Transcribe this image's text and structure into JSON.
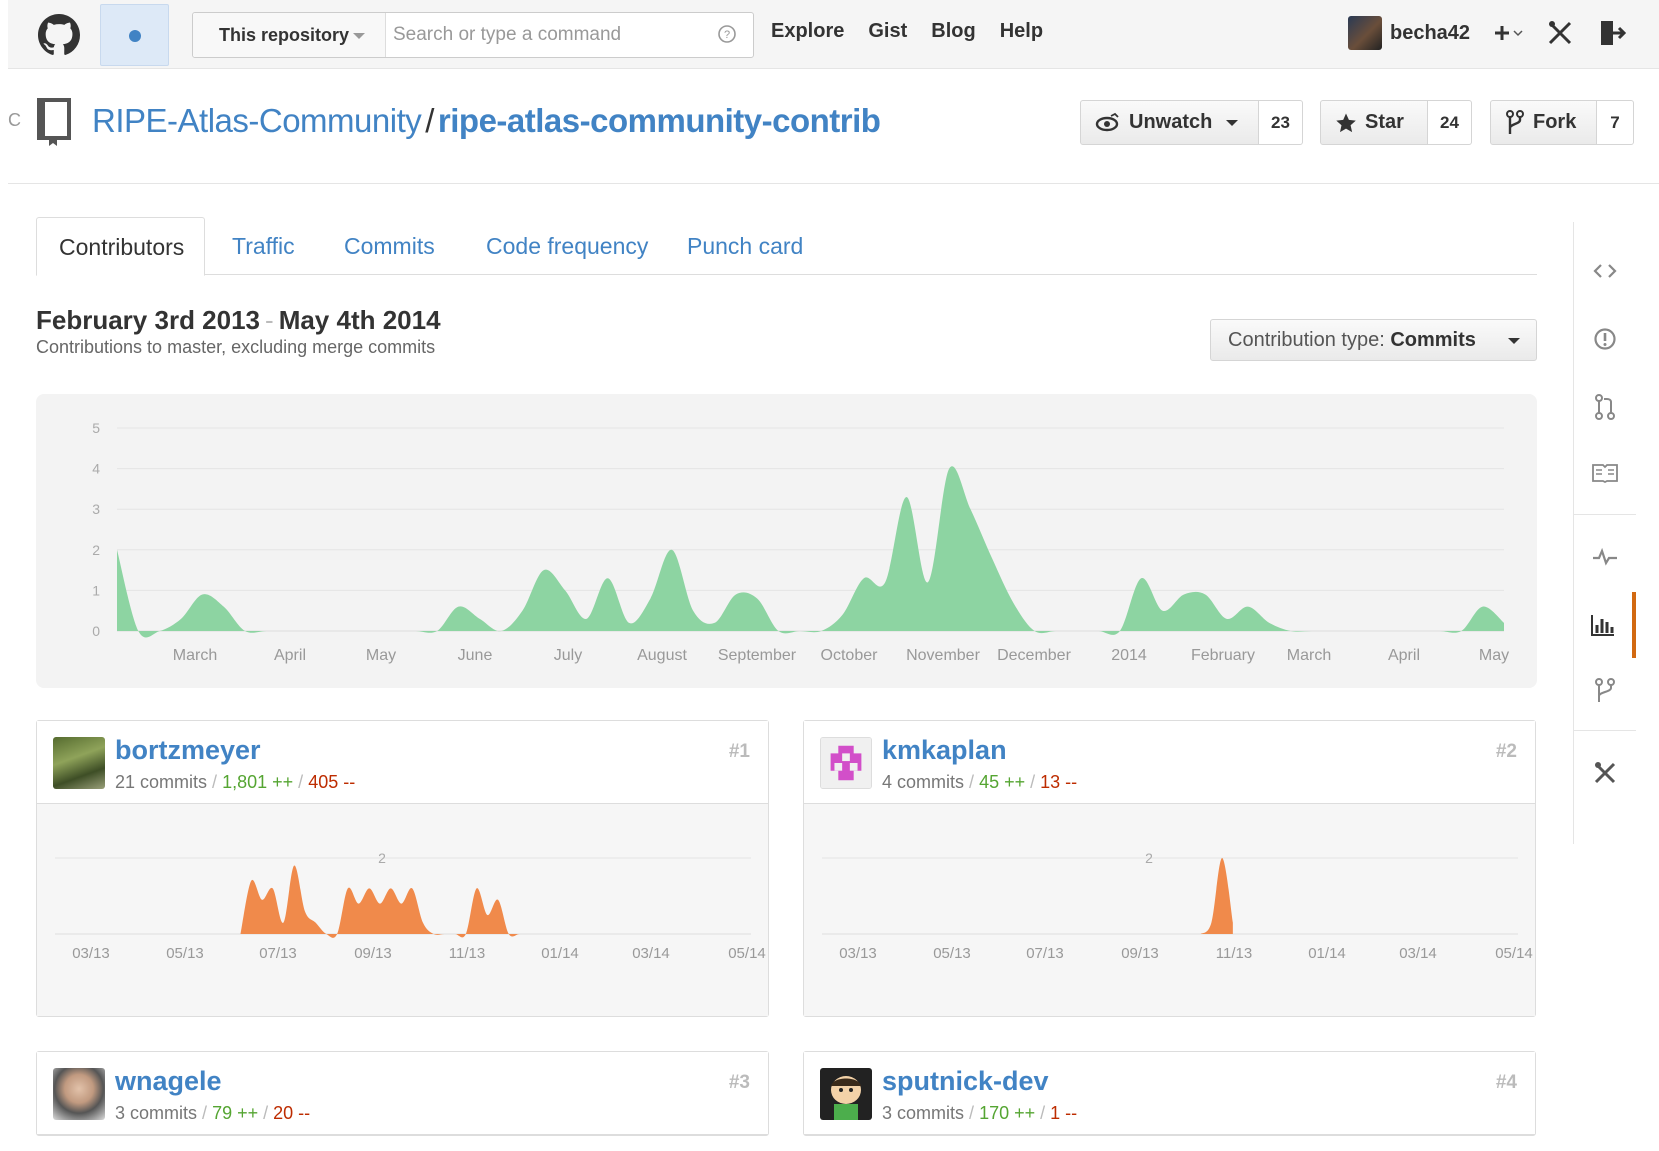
{
  "header": {
    "search_scope": "This repository",
    "search_placeholder": "Search or type a command",
    "nav": [
      "Explore",
      "Gist",
      "Blog",
      "Help"
    ],
    "username": "becha42",
    "icons": [
      "github-logo-icon",
      "notification-dot-icon",
      "help-icon",
      "plus-icon",
      "tools-icon",
      "sign-out-icon"
    ]
  },
  "repo": {
    "stub": "C",
    "owner": "RIPE-Atlas-Community",
    "separator": "/",
    "name": "ripe-atlas-community-contrib",
    "watch_label": "Unwatch",
    "watch_count": "23",
    "star_label": "Star",
    "star_count": "24",
    "fork_label": "Fork",
    "fork_count": "7"
  },
  "tabs": [
    "Contributors",
    "Traffic",
    "Commits",
    "Code frequency",
    "Punch card"
  ],
  "range": {
    "start": "February 3rd 2013",
    "dash": "-",
    "end": "May 4th 2014",
    "subtitle": "Contributions to master, excluding merge commits",
    "type_label": "Contribution type:",
    "type_value": "Commits"
  },
  "colors": {
    "link": "#4183c4",
    "main_area": "#8dd4a2",
    "contrib_area": "#f08a4b",
    "active_tab_accent": "#d26911"
  },
  "sidebar_icons": [
    "code-icon",
    "issues-icon",
    "pull-request-icon",
    "wiki-icon",
    "pulse-icon",
    "graphs-icon",
    "network-icon",
    "settings-icon"
  ],
  "chart_data": [
    {
      "type": "area",
      "title": "",
      "xlabel": "",
      "ylabel": "",
      "ylim": [
        0,
        5
      ],
      "yticks": [
        "0",
        "1",
        "2",
        "3",
        "4",
        "5"
      ],
      "xticks": [
        "March",
        "April",
        "May",
        "June",
        "July",
        "August",
        "September",
        "October",
        "November",
        "December",
        "2014",
        "February",
        "March",
        "April",
        "May"
      ],
      "grid": true,
      "x": [
        "2013-02-03",
        "2013-02-10",
        "2013-02-17",
        "2013-02-24",
        "2013-03-03",
        "2013-03-10",
        "2013-03-17",
        "2013-03-24",
        "2013-03-31",
        "2013-04-07",
        "2013-04-14",
        "2013-04-21",
        "2013-04-28",
        "2013-05-05",
        "2013-05-12",
        "2013-05-19",
        "2013-05-26",
        "2013-06-02",
        "2013-06-09",
        "2013-06-16",
        "2013-06-23",
        "2013-06-30",
        "2013-07-07",
        "2013-07-14",
        "2013-07-21",
        "2013-07-28",
        "2013-08-04",
        "2013-08-11",
        "2013-08-18",
        "2013-08-25",
        "2013-09-01",
        "2013-09-08",
        "2013-09-15",
        "2013-09-22",
        "2013-09-29",
        "2013-10-06",
        "2013-10-13",
        "2013-10-20",
        "2013-10-27",
        "2013-11-03",
        "2013-11-10",
        "2013-11-17",
        "2013-11-24",
        "2013-12-01",
        "2013-12-08",
        "2013-12-15",
        "2013-12-22",
        "2013-12-29",
        "2014-01-05",
        "2014-01-12",
        "2014-01-19",
        "2014-01-26",
        "2014-02-02",
        "2014-02-09",
        "2014-02-16",
        "2014-02-23",
        "2014-03-02",
        "2014-03-09",
        "2014-03-16",
        "2014-03-23",
        "2014-03-30",
        "2014-04-06",
        "2014-04-13",
        "2014-04-20",
        "2014-04-27",
        "2014-05-04"
      ],
      "series": [
        {
          "values": [
            2,
            0,
            0,
            0.3,
            0.9,
            0.6,
            0,
            0,
            0,
            0,
            0,
            0,
            0,
            0,
            0,
            0,
            0.6,
            0.3,
            0,
            0.5,
            1.5,
            1,
            0.3,
            1.3,
            0.2,
            0.8,
            2,
            0.5,
            0.2,
            0.9,
            0.8,
            0,
            0,
            0,
            0.4,
            1.3,
            1.2,
            3.3,
            1.2,
            4,
            3,
            1.8,
            0.7,
            0,
            0,
            0,
            0,
            0,
            1.3,
            0.5,
            0.9,
            0.9,
            0.3,
            0.6,
            0.2,
            0,
            0,
            0,
            0,
            0,
            0,
            0,
            0,
            0,
            0.6,
            0.2,
            0,
            0,
            0,
            0,
            0,
            0,
            0,
            0,
            0,
            0,
            0,
            1
          ]
        }
      ]
    },
    {
      "type": "area",
      "title": "",
      "ylim": [
        0,
        2
      ],
      "yticks": [
        "2"
      ],
      "xticks": [
        "03/13",
        "05/13",
        "07/13",
        "09/13",
        "11/13",
        "01/14",
        "03/14",
        "05/14"
      ],
      "x": [
        "2013-06-02",
        "2013-06-09",
        "2013-06-16",
        "2013-06-23",
        "2013-06-30",
        "2013-07-07",
        "2013-07-14",
        "2013-07-21",
        "2013-07-28",
        "2013-08-04",
        "2013-08-11",
        "2013-08-18",
        "2013-08-25",
        "2013-09-01",
        "2013-09-08",
        "2013-09-15",
        "2013-09-22",
        "2013-09-29",
        "2013-10-06",
        "2013-10-13",
        "2013-10-20",
        "2013-10-27",
        "2013-11-03",
        "2013-11-10",
        "2013-11-17",
        "2013-11-24",
        "2013-12-01",
        "2013-12-08",
        "2013-12-15",
        "2013-12-22"
      ],
      "series": [
        {
          "values": [
            0,
            1.4,
            0.9,
            1.2,
            0.3,
            1.8,
            0.6,
            0.3,
            0,
            0,
            1.2,
            0.8,
            1.2,
            0.8,
            1.2,
            0.8,
            1.2,
            0.3,
            0,
            0,
            0,
            0,
            1.2,
            0.5,
            0.9,
            0,
            0,
            0,
            0,
            0
          ]
        }
      ]
    },
    {
      "type": "area",
      "title": "",
      "ylim": [
        0,
        2
      ],
      "yticks": [
        "2"
      ],
      "xticks": [
        "03/13",
        "05/13",
        "07/13",
        "09/13",
        "11/13",
        "01/14",
        "03/14",
        "05/14"
      ],
      "x": [
        "2013-10-06",
        "2013-10-13",
        "2013-10-20",
        "2013-10-27"
      ],
      "series": [
        {
          "values": [
            0,
            0.3,
            2,
            0.3
          ]
        }
      ]
    }
  ],
  "contributors": [
    {
      "name": "bortzmeyer",
      "rank": "#1",
      "commits": "21 commits",
      "additions": "1,801 ++",
      "deletions": "405 --",
      "chart_index": 1
    },
    {
      "name": "kmkaplan",
      "rank": "#2",
      "commits": "4 commits",
      "additions": "45 ++",
      "deletions": "13 --",
      "chart_index": 2
    },
    {
      "name": "wnagele",
      "rank": "#3",
      "commits": "3 commits",
      "additions": "79 ++",
      "deletions": "20 --"
    },
    {
      "name": "sputnick-dev",
      "rank": "#4",
      "commits": "3 commits",
      "additions": "170 ++",
      "deletions": "1 --"
    }
  ],
  "stat_separator": "/"
}
